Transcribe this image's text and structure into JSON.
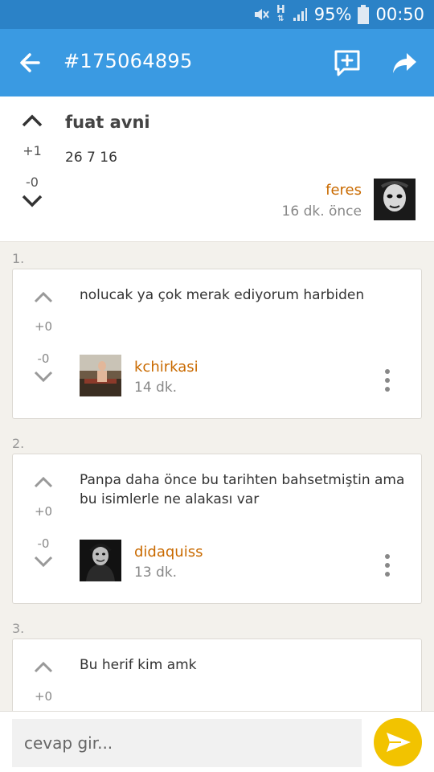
{
  "status_bar": {
    "battery": "95%",
    "time": "00:50"
  },
  "app_bar": {
    "title": "#175064895",
    "back_icon": "back-arrow-icon",
    "add_icon": "add-comment-icon",
    "share_icon": "share-icon"
  },
  "entry": {
    "title": "fuat avni",
    "body": "26 7 16",
    "upvotes": "+1",
    "downvotes": "-0",
    "author": "feres",
    "time": "16 dk. önce"
  },
  "comments": [
    {
      "number": "1.",
      "text": "nolucak ya çok merak ediyorum harbiden",
      "upvotes": "+0",
      "downvotes": "-0",
      "author": "kchirkasi",
      "time": "14 dk."
    },
    {
      "number": "2.",
      "text": "Panpa daha önce bu tarihten bahsetmiştin ama bu isimlerle ne alakası var",
      "upvotes": "+0",
      "downvotes": "-0",
      "author": "didaquiss",
      "time": "13 dk."
    },
    {
      "number": "3.",
      "text": "Bu herif kim amk",
      "upvotes": "+0"
    }
  ],
  "reply": {
    "placeholder": "cevap gir..."
  },
  "colors": {
    "statusbar": "#2b82c7",
    "appbar": "#3a9ae2",
    "author": "#c96a00",
    "send": "#f2c300"
  }
}
